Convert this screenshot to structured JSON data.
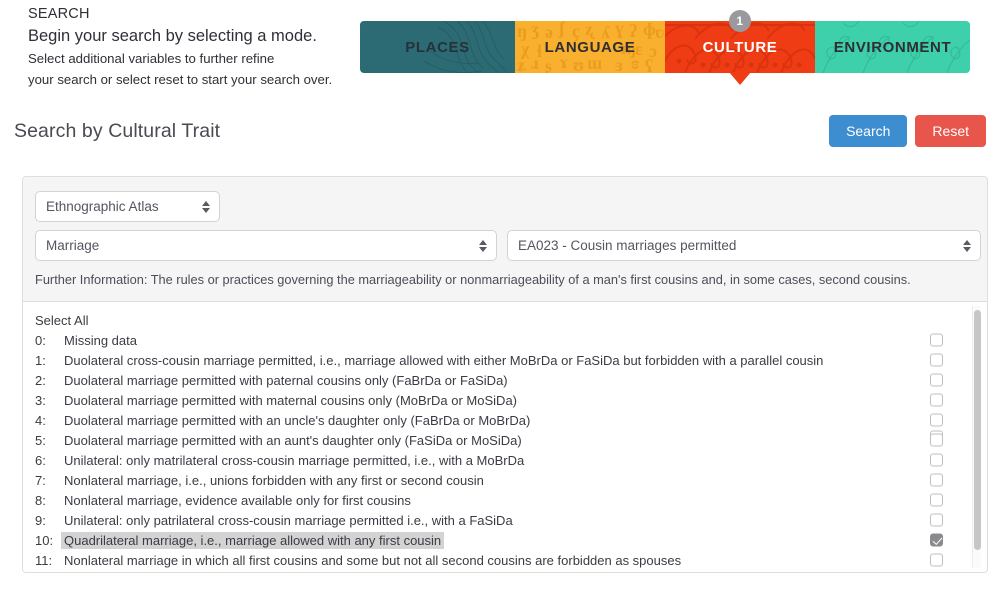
{
  "intro": {
    "kicker": "SEARCH",
    "lead": "Begin your search by selecting a mode.",
    "sub_line1": "Select additional variables to further refine",
    "sub_line2": "your search or select reset to start your search over."
  },
  "modes": {
    "badge_count": "1",
    "tabs": [
      {
        "label": "PLACES",
        "color": "#2d6b74",
        "active": false
      },
      {
        "label": "LANGUAGE",
        "color": "#f8b02e",
        "active": false
      },
      {
        "label": "CULTURE",
        "color": "#f03c14",
        "active": true
      },
      {
        "label": "ENVIRONMENT",
        "color": "#3ecfab",
        "active": false
      }
    ]
  },
  "page": {
    "title": "Search by Cultural Trait",
    "search_label": "Search",
    "reset_label": "Reset",
    "search_color": "#3d8ed0",
    "reset_color": "#e8554b"
  },
  "filters": {
    "dataset": "Ethnographic Atlas",
    "category": "Marriage",
    "variable": "EA023 - Cousin marriages permitted",
    "further_information": "Further Information: The rules or practices governing the marriageability or nonmarriageability of a man's first cousins and, in some cases, second cousins."
  },
  "options": {
    "select_all_label": "Select All",
    "items": [
      {
        "num": "0:",
        "text": "Missing data",
        "checked": false,
        "selected": false
      },
      {
        "num": "1:",
        "text": "Duolateral cross-cousin marriage permitted, i.e., marriage allowed with either MoBrDa or FaSiDa but forbidden with a parallel cousin",
        "checked": false,
        "selected": false
      },
      {
        "num": "2:",
        "text": "Duolateral marriage permitted with paternal cousins only (FaBrDa or FaSiDa)",
        "checked": false,
        "selected": false
      },
      {
        "num": "3:",
        "text": "Duolateral marriage permitted with maternal cousins only (MoBrDa or MoSiDa)",
        "checked": false,
        "selected": false
      },
      {
        "num": "4:",
        "text": "Duolateral marriage permitted with an uncle's daughter only (FaBrDa or MoBrDa)",
        "checked": false,
        "selected": false
      },
      {
        "num": "5:",
        "text": "Duolateral marriage permitted with an aunt's daughter only (FaSiDa or MoSiDa)",
        "checked": false,
        "selected": false
      },
      {
        "num": "6:",
        "text": "Unilateral: only matrilateral cross-cousin marriage permitted, i.e., with a MoBrDa",
        "checked": false,
        "selected": false
      },
      {
        "num": "7:",
        "text": "Nonlateral marriage, i.e., unions forbidden with any first or second cousin",
        "checked": false,
        "selected": false
      },
      {
        "num": "8:",
        "text": "Nonlateral marriage, evidence available only for first cousins",
        "checked": false,
        "selected": false
      },
      {
        "num": "9:",
        "text": "Unilateral: only patrilateral cross-cousin marriage permitted i.e., with a FaSiDa",
        "checked": false,
        "selected": false
      },
      {
        "num": "10:",
        "text": "Quadrilateral marriage, i.e., marriage allowed with any first cousin",
        "checked": true,
        "selected": true
      },
      {
        "num": "11:",
        "text": "Nonlateral marriage in which all first cousins and some but not all second cousins are forbidden as spouses",
        "checked": false,
        "selected": false
      }
    ]
  }
}
